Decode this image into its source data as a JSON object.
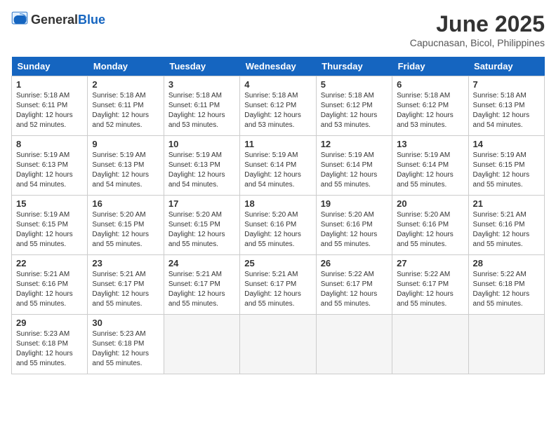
{
  "header": {
    "logo_general": "General",
    "logo_blue": "Blue",
    "title": "June 2025",
    "subtitle": "Capucnasan, Bicol, Philippines"
  },
  "calendar": {
    "days_of_week": [
      "Sunday",
      "Monday",
      "Tuesday",
      "Wednesday",
      "Thursday",
      "Friday",
      "Saturday"
    ],
    "weeks": [
      [
        {
          "day": "",
          "empty": true
        },
        {
          "day": "",
          "empty": true
        },
        {
          "day": "",
          "empty": true
        },
        {
          "day": "",
          "empty": true
        },
        {
          "day": "",
          "empty": true
        },
        {
          "day": "",
          "empty": true
        },
        {
          "day": "",
          "empty": true
        }
      ],
      [
        {
          "day": "1",
          "sunrise": "5:18 AM",
          "sunset": "6:11 PM",
          "daylight": "12 hours and 52 minutes."
        },
        {
          "day": "2",
          "sunrise": "5:18 AM",
          "sunset": "6:11 PM",
          "daylight": "12 hours and 52 minutes."
        },
        {
          "day": "3",
          "sunrise": "5:18 AM",
          "sunset": "6:11 PM",
          "daylight": "12 hours and 53 minutes."
        },
        {
          "day": "4",
          "sunrise": "5:18 AM",
          "sunset": "6:12 PM",
          "daylight": "12 hours and 53 minutes."
        },
        {
          "day": "5",
          "sunrise": "5:18 AM",
          "sunset": "6:12 PM",
          "daylight": "12 hours and 53 minutes."
        },
        {
          "day": "6",
          "sunrise": "5:18 AM",
          "sunset": "6:12 PM",
          "daylight": "12 hours and 53 minutes."
        },
        {
          "day": "7",
          "sunrise": "5:18 AM",
          "sunset": "6:13 PM",
          "daylight": "12 hours and 54 minutes."
        }
      ],
      [
        {
          "day": "8",
          "sunrise": "5:19 AM",
          "sunset": "6:13 PM",
          "daylight": "12 hours and 54 minutes."
        },
        {
          "day": "9",
          "sunrise": "5:19 AM",
          "sunset": "6:13 PM",
          "daylight": "12 hours and 54 minutes."
        },
        {
          "day": "10",
          "sunrise": "5:19 AM",
          "sunset": "6:13 PM",
          "daylight": "12 hours and 54 minutes."
        },
        {
          "day": "11",
          "sunrise": "5:19 AM",
          "sunset": "6:14 PM",
          "daylight": "12 hours and 54 minutes."
        },
        {
          "day": "12",
          "sunrise": "5:19 AM",
          "sunset": "6:14 PM",
          "daylight": "12 hours and 55 minutes."
        },
        {
          "day": "13",
          "sunrise": "5:19 AM",
          "sunset": "6:14 PM",
          "daylight": "12 hours and 55 minutes."
        },
        {
          "day": "14",
          "sunrise": "5:19 AM",
          "sunset": "6:15 PM",
          "daylight": "12 hours and 55 minutes."
        }
      ],
      [
        {
          "day": "15",
          "sunrise": "5:19 AM",
          "sunset": "6:15 PM",
          "daylight": "12 hours and 55 minutes."
        },
        {
          "day": "16",
          "sunrise": "5:20 AM",
          "sunset": "6:15 PM",
          "daylight": "12 hours and 55 minutes."
        },
        {
          "day": "17",
          "sunrise": "5:20 AM",
          "sunset": "6:15 PM",
          "daylight": "12 hours and 55 minutes."
        },
        {
          "day": "18",
          "sunrise": "5:20 AM",
          "sunset": "6:16 PM",
          "daylight": "12 hours and 55 minutes."
        },
        {
          "day": "19",
          "sunrise": "5:20 AM",
          "sunset": "6:16 PM",
          "daylight": "12 hours and 55 minutes."
        },
        {
          "day": "20",
          "sunrise": "5:20 AM",
          "sunset": "6:16 PM",
          "daylight": "12 hours and 55 minutes."
        },
        {
          "day": "21",
          "sunrise": "5:21 AM",
          "sunset": "6:16 PM",
          "daylight": "12 hours and 55 minutes."
        }
      ],
      [
        {
          "day": "22",
          "sunrise": "5:21 AM",
          "sunset": "6:16 PM",
          "daylight": "12 hours and 55 minutes."
        },
        {
          "day": "23",
          "sunrise": "5:21 AM",
          "sunset": "6:17 PM",
          "daylight": "12 hours and 55 minutes."
        },
        {
          "day": "24",
          "sunrise": "5:21 AM",
          "sunset": "6:17 PM",
          "daylight": "12 hours and 55 minutes."
        },
        {
          "day": "25",
          "sunrise": "5:21 AM",
          "sunset": "6:17 PM",
          "daylight": "12 hours and 55 minutes."
        },
        {
          "day": "26",
          "sunrise": "5:22 AM",
          "sunset": "6:17 PM",
          "daylight": "12 hours and 55 minutes."
        },
        {
          "day": "27",
          "sunrise": "5:22 AM",
          "sunset": "6:17 PM",
          "daylight": "12 hours and 55 minutes."
        },
        {
          "day": "28",
          "sunrise": "5:22 AM",
          "sunset": "6:18 PM",
          "daylight": "12 hours and 55 minutes."
        }
      ],
      [
        {
          "day": "29",
          "sunrise": "5:23 AM",
          "sunset": "6:18 PM",
          "daylight": "12 hours and 55 minutes."
        },
        {
          "day": "30",
          "sunrise": "5:23 AM",
          "sunset": "6:18 PM",
          "daylight": "12 hours and 55 minutes."
        },
        {
          "day": "",
          "empty": true
        },
        {
          "day": "",
          "empty": true
        },
        {
          "day": "",
          "empty": true
        },
        {
          "day": "",
          "empty": true
        },
        {
          "day": "",
          "empty": true
        }
      ]
    ]
  },
  "labels": {
    "sunrise": "Sunrise:",
    "sunset": "Sunset:",
    "daylight": "Daylight:"
  }
}
